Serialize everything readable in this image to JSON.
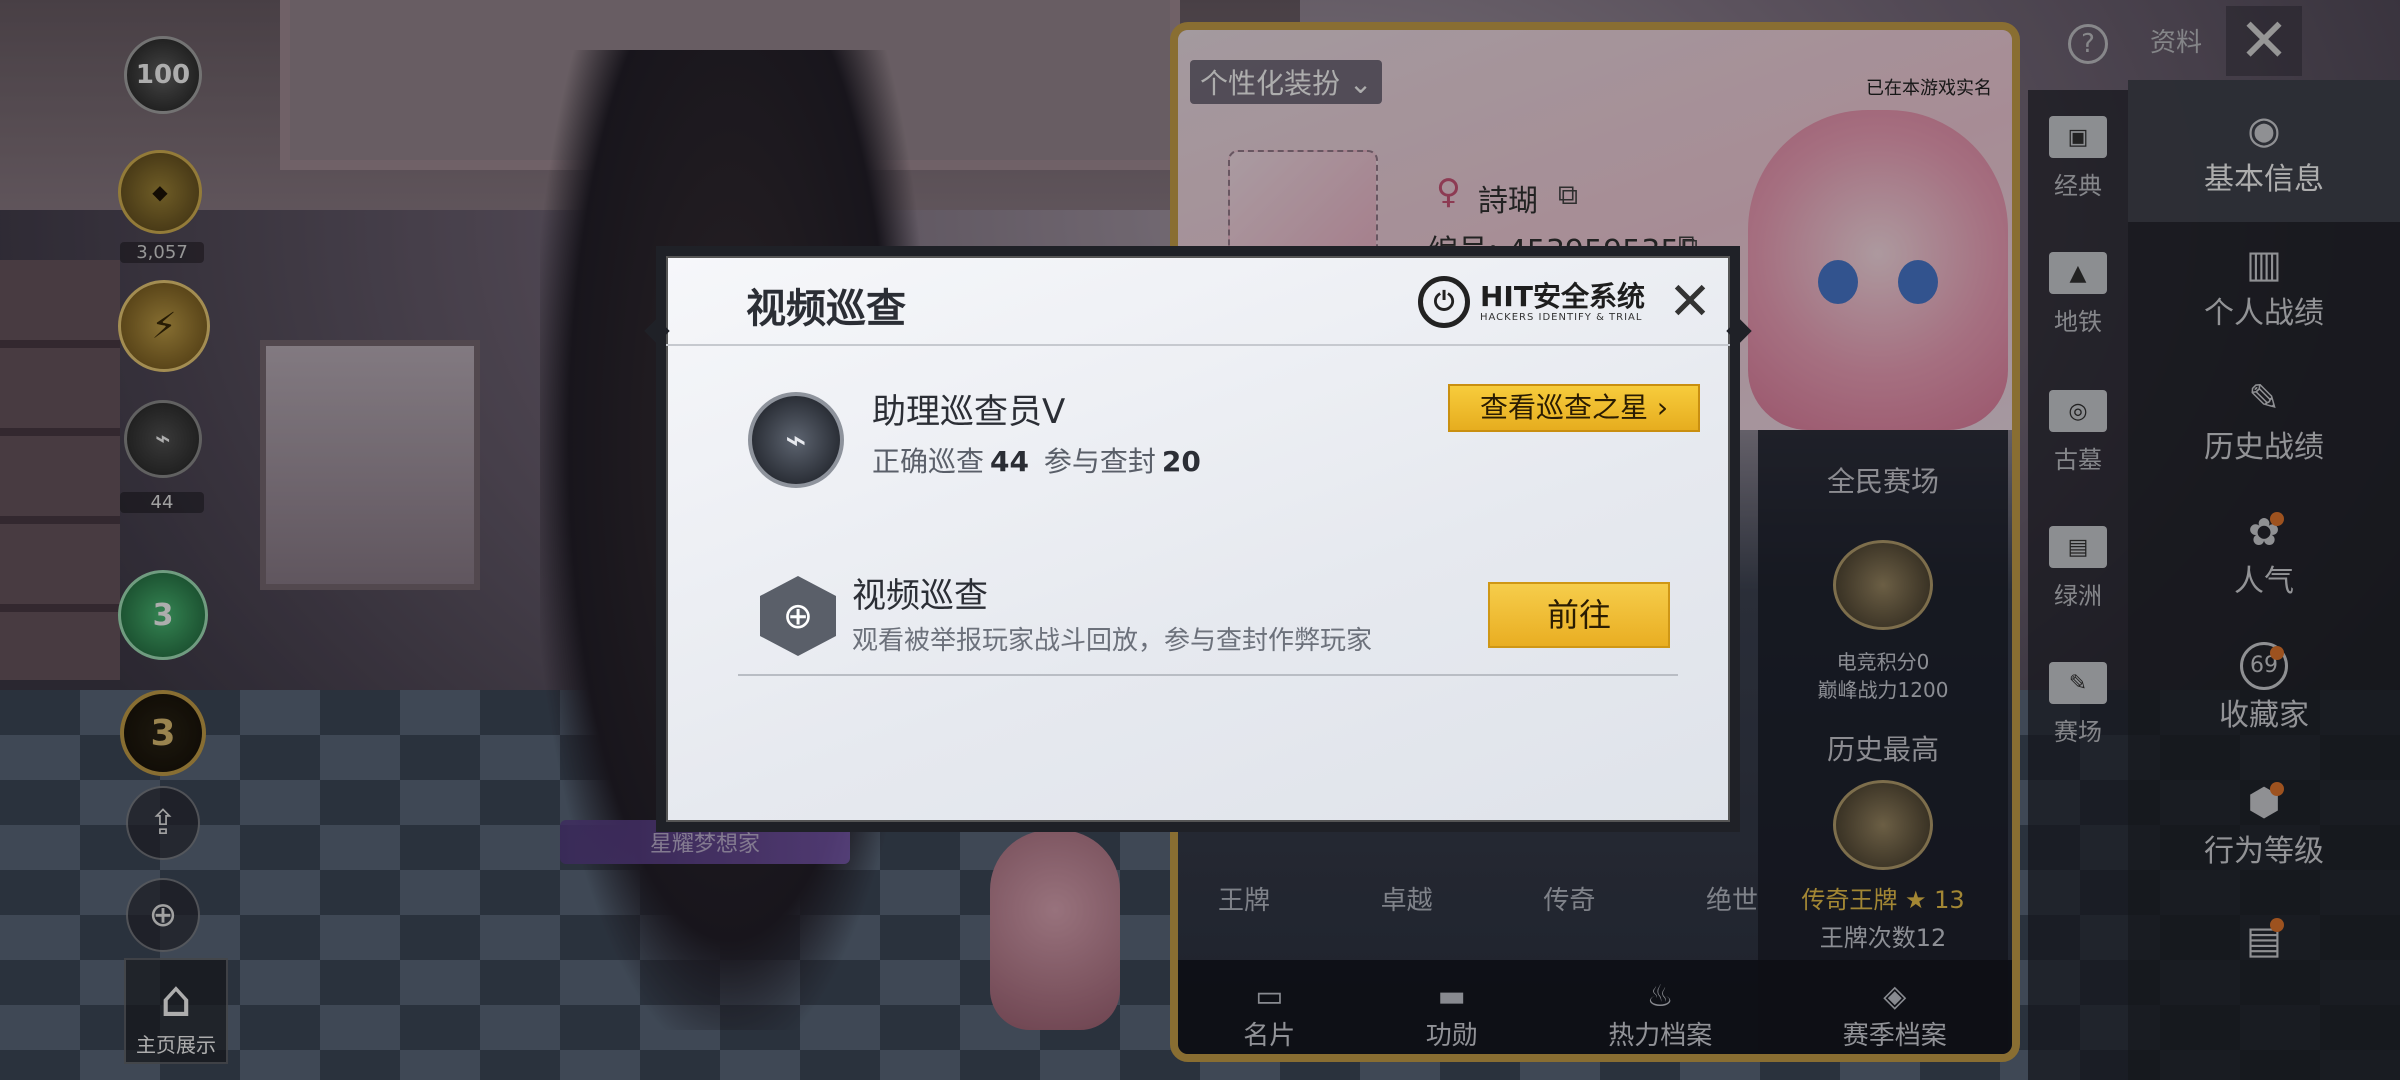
{
  "left_rail": {
    "badge_top": "100",
    "badge_gold_small": "",
    "badge_count": "3,057",
    "badge_44": "44",
    "badge_green": "3",
    "badge_three": "3",
    "home_show_label": "主页展示"
  },
  "character": {
    "nickname_plate": "星耀梦想家"
  },
  "profile_card": {
    "title": "个性化装扮",
    "realname_status": "已在本游戏实名",
    "player_name": "詩瑚",
    "player_id": "编号: 4539595355",
    "stats_title": "全民赛场",
    "esports_points": "电竞积分0",
    "peak_power": "巅峰战力1200",
    "history_best": "历史最高",
    "best_rank": "传奇王牌",
    "best_stars": "13",
    "ace_times": "王牌次数12",
    "ranks": [
      "王牌",
      "卓越",
      "传奇",
      "绝世"
    ],
    "bottom_tabs": [
      {
        "label": "名片",
        "icon": "id-card-icon"
      },
      {
        "label": "功勋",
        "icon": "medal-icon"
      },
      {
        "label": "热力档案",
        "icon": "flame-icon"
      },
      {
        "label": "赛季档案",
        "icon": "season-icon"
      }
    ]
  },
  "header_right": {
    "resource_label": "资料",
    "help_glyph": "?"
  },
  "mode_column": {
    "items": [
      "经典",
      "地铁",
      "古墓",
      "绿洲",
      "赛场"
    ]
  },
  "info_column": {
    "items": [
      "基本信息",
      "个人战绩",
      "历史战绩",
      "人气",
      "收藏家",
      "行为等级"
    ],
    "collector_badge": "69"
  },
  "modal": {
    "title": "视频巡查",
    "brand_name": "HIT安全系统",
    "brand_sub": "HACKERS IDENTIFY & TRIAL",
    "rank_title": "助理巡查员V",
    "correct_label": "正确巡查",
    "correct_value": "44",
    "participate_label": "参与查封",
    "participate_value": "20",
    "star_button": "查看巡查之星",
    "patrol_title": "视频巡查",
    "patrol_desc": "观看被举报玩家战斗回放，参与查封作弊玩家",
    "go_button": "前往"
  },
  "colors": {
    "gold_button": "#f2c23a",
    "modal_bg": "#eef0f4",
    "frame_gold": "#caa24a"
  }
}
